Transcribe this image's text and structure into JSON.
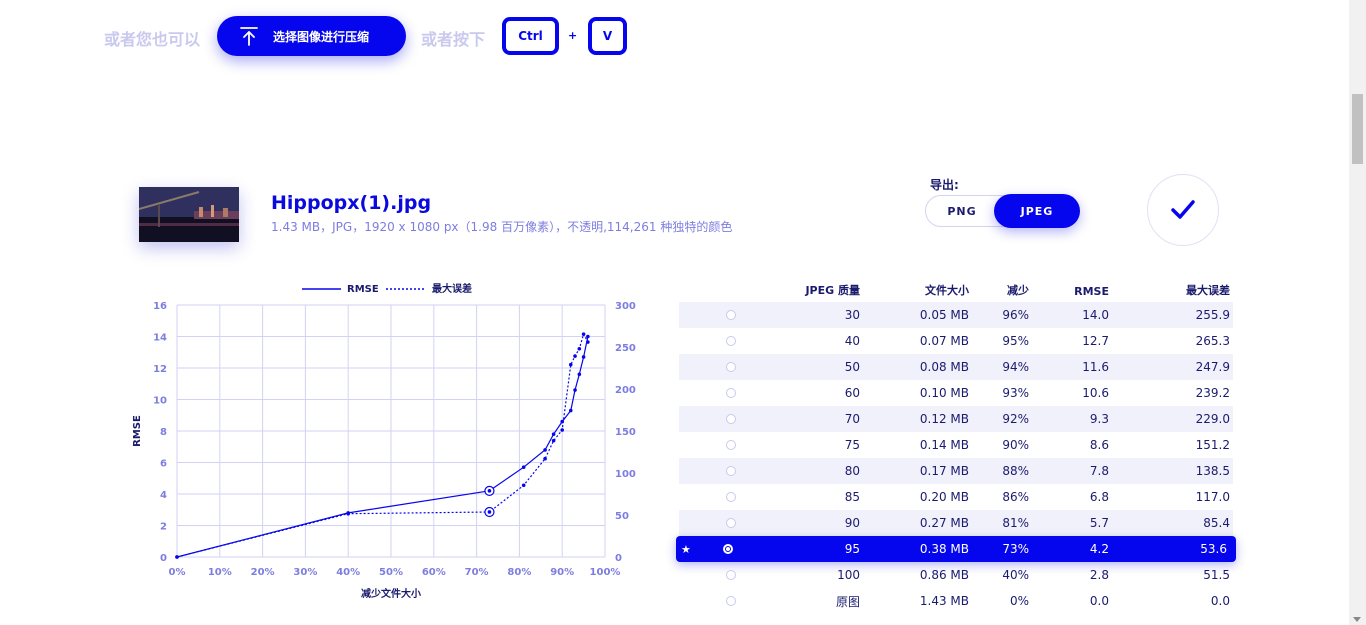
{
  "top_bar": {
    "or_label_1": "或者您也可以",
    "upload_button": "选择图像进行压缩",
    "or_label_2": "或者按下",
    "key_ctrl": "Ctrl",
    "key_plus": "+",
    "key_v": "V"
  },
  "file": {
    "name": "Hippopx(1).jpg",
    "meta": "1.43 MB，JPG，1920 x 1080 px（1.98 百万像素），不透明,114,261 种独特的颜色"
  },
  "export": {
    "label": "导出:",
    "formats": [
      "PNG",
      "JPEG"
    ],
    "selected": "JPEG"
  },
  "colors": {
    "accent": "#0606ee",
    "muted_text": "#c9c9ee",
    "meta_text": "#7d7de0",
    "dark_text": "#1b1b6e",
    "grid": "#d2d2f4",
    "row_alt": "#f1f1fb"
  },
  "icons": {
    "upload": "upload-arrow-icon",
    "confirm": "checkmark-icon",
    "star": "star-icon"
  },
  "chart_data": {
    "type": "line",
    "xlabel": "减少文件大小",
    "ylabel": "RMSE",
    "y2label": "最大误差",
    "xlim": [
      0,
      100
    ],
    "ylim": [
      0,
      16
    ],
    "y2lim": [
      0,
      300
    ],
    "x_ticks": [
      "0%",
      "10%",
      "20%",
      "30%",
      "40%",
      "50%",
      "60%",
      "70%",
      "80%",
      "90%",
      "100%"
    ],
    "y_ticks": [
      "0",
      "2",
      "4",
      "6",
      "8",
      "10",
      "12",
      "14",
      "16"
    ],
    "y2_ticks": [
      "0",
      "50",
      "100",
      "150",
      "200",
      "250",
      "300"
    ],
    "legend": {
      "placement": "top-center"
    },
    "grid": true,
    "series": [
      {
        "name": "RMSE",
        "axis": "left",
        "style": "solid",
        "x": [
          0,
          40,
          73,
          81,
          86,
          88,
          90,
          92,
          93,
          94,
          95,
          96
        ],
        "y": [
          0.0,
          2.8,
          4.2,
          5.7,
          6.8,
          7.8,
          8.6,
          9.3,
          10.6,
          11.6,
          12.7,
          14.0
        ]
      },
      {
        "name": "最大误差",
        "axis": "right",
        "style": "dotted",
        "x": [
          0,
          40,
          73,
          81,
          86,
          88,
          90,
          92,
          93,
          94,
          95,
          96
        ],
        "y": [
          0.0,
          51.5,
          53.6,
          85.4,
          117.0,
          138.5,
          151.2,
          229.0,
          239.2,
          247.9,
          265.3,
          255.9
        ]
      }
    ],
    "highlight_x": 73
  },
  "table": {
    "headers": [
      "JPEG 质量",
      "文件大小",
      "减少",
      "RMSE",
      "最大误差"
    ],
    "rows": [
      {
        "q": "30",
        "size": "0.05 MB",
        "red": "96%",
        "rmse": "14.0",
        "max": "255.9"
      },
      {
        "q": "40",
        "size": "0.07 MB",
        "red": "95%",
        "rmse": "12.7",
        "max": "265.3"
      },
      {
        "q": "50",
        "size": "0.08 MB",
        "red": "94%",
        "rmse": "11.6",
        "max": "247.9"
      },
      {
        "q": "60",
        "size": "0.10 MB",
        "red": "93%",
        "rmse": "10.6",
        "max": "239.2"
      },
      {
        "q": "70",
        "size": "0.12 MB",
        "red": "92%",
        "rmse": "9.3",
        "max": "229.0"
      },
      {
        "q": "75",
        "size": "0.14 MB",
        "red": "90%",
        "rmse": "8.6",
        "max": "151.2"
      },
      {
        "q": "80",
        "size": "0.17 MB",
        "red": "88%",
        "rmse": "7.8",
        "max": "138.5"
      },
      {
        "q": "85",
        "size": "0.20 MB",
        "red": "86%",
        "rmse": "6.8",
        "max": "117.0"
      },
      {
        "q": "90",
        "size": "0.27 MB",
        "red": "81%",
        "rmse": "5.7",
        "max": "85.4"
      },
      {
        "q": "95",
        "size": "0.38 MB",
        "red": "73%",
        "rmse": "4.2",
        "max": "53.6",
        "selected": true
      },
      {
        "q": "100",
        "size": "0.86 MB",
        "red": "40%",
        "rmse": "2.8",
        "max": "51.5"
      },
      {
        "q": "原图",
        "size": "1.43 MB",
        "red": "0%",
        "rmse": "0.0",
        "max": "0.0"
      }
    ]
  }
}
